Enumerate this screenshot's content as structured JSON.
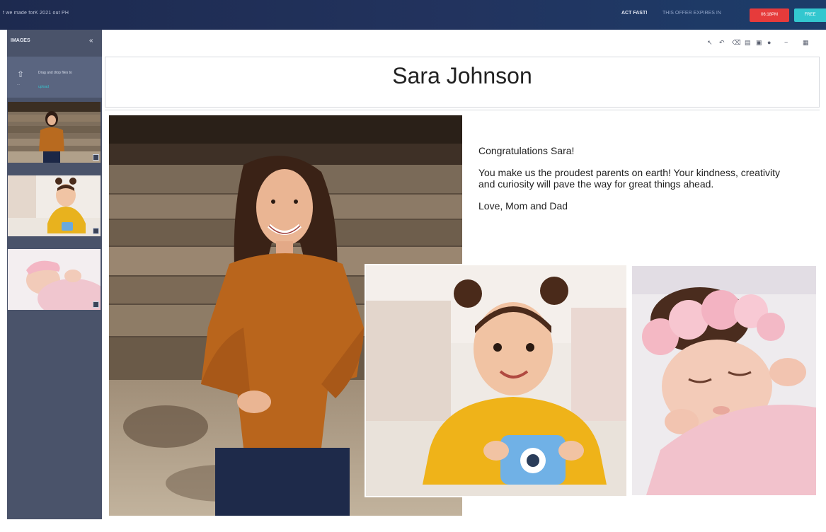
{
  "topbar": {
    "promo_text": "f we made forK 2021 out PH",
    "act_label": "ACT FAST!",
    "expires_label": "THIS OFFER EXPIRES IN",
    "countdown_label": "06:18PM",
    "cta_label": "FREE",
    "colors": {
      "bar": "#1d2a4f",
      "countdown": "#e63b3b",
      "cta": "#33c7cf"
    }
  },
  "sidebar": {
    "header": "IMAGES",
    "collapse_icon": "double-chevron-left-icon",
    "upload": {
      "icon": "upload-icon",
      "sublabel": "...",
      "text": "Drag and drop files to",
      "link": "upload"
    },
    "thumbnails": [
      {
        "subject": "woman-orange-sweater"
      },
      {
        "subject": "toddler-yellow-sweater"
      },
      {
        "subject": "newborn-pink-headband"
      }
    ]
  },
  "toolbar": {
    "icons": [
      "pointer-icon",
      "undo-icon",
      "delete-icon",
      "layers-icon",
      "crop-icon",
      "color-icon",
      "minus-icon",
      "grid-icon"
    ]
  },
  "document": {
    "title": "Sara Johnson",
    "message": {
      "greeting": "Congratulations Sara!",
      "body": "You make us the proudest parents on earth! Your kindness, creativity and curiosity will pave the way for great things ahead.",
      "signoff": "Love, Mom and Dad"
    }
  }
}
